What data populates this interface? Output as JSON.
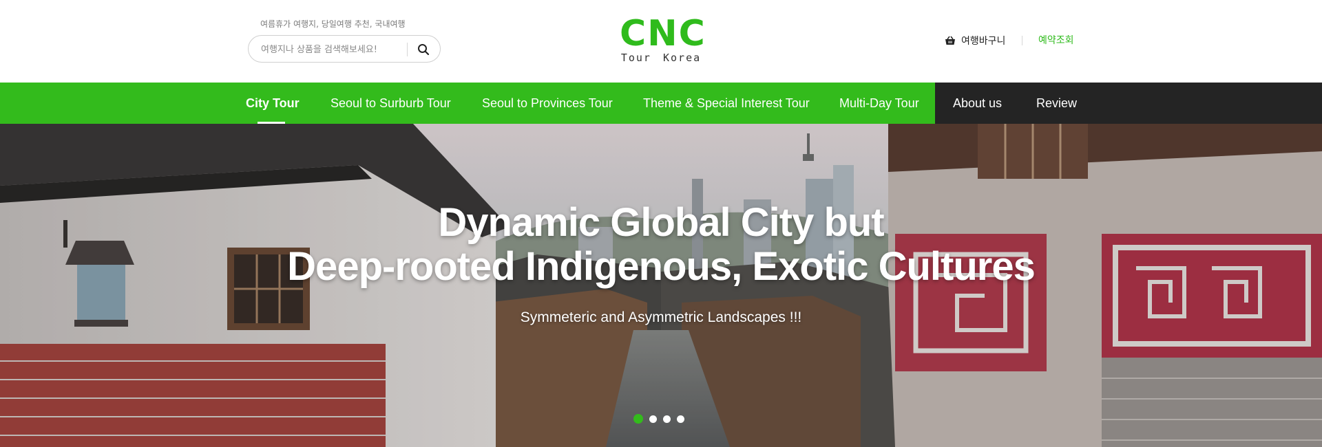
{
  "search": {
    "hint": "여름휴가 여행지, 당일여행 추천, 국내여행",
    "placeholder": "여행지나 상품을 검색해보세요!"
  },
  "logo": {
    "main": "CNC",
    "sub": "Tour Korea"
  },
  "header_links": {
    "cart": "여행바구니",
    "reservation": "예약조회"
  },
  "nav": {
    "items": [
      {
        "label": "City Tour"
      },
      {
        "label": "Seoul to Surburb Tour"
      },
      {
        "label": "Seoul to Provinces Tour"
      },
      {
        "label": "Theme & Special Interest Tour"
      },
      {
        "label": "Multi-Day Tour"
      },
      {
        "label": "About us"
      },
      {
        "label": "Review"
      }
    ],
    "active_index": 0
  },
  "hero": {
    "title_line1": "Dynamic Global City but",
    "title_line2": "Deep-rooted Indigenous, Exotic Cultures",
    "subtitle": "Symmeteric and Asymmetric Landscapes !!!",
    "slide_count": 4,
    "active_slide": 1
  },
  "colors": {
    "brand_green": "#33bb1c",
    "nav_dark": "#242424",
    "logo_green": "#2fbb1c"
  },
  "icons": {
    "search": "search-icon",
    "cart": "basket-icon"
  }
}
